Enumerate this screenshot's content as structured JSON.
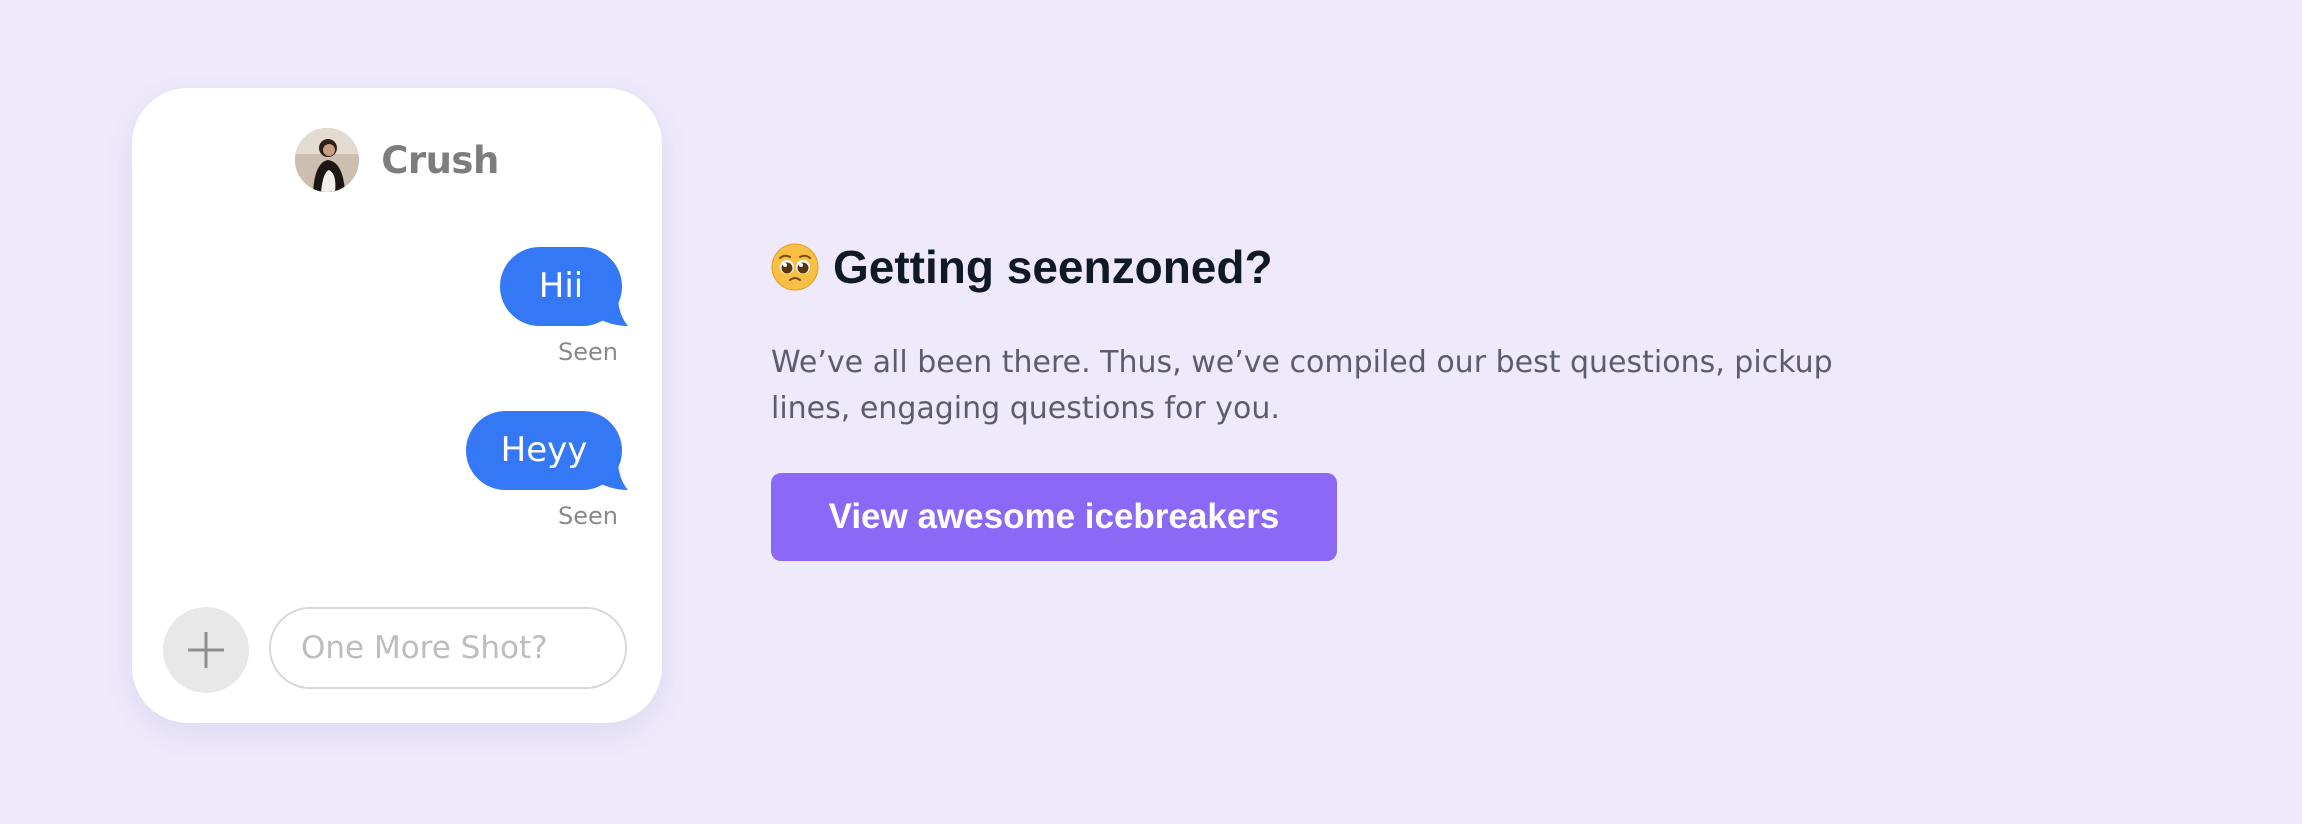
{
  "chat": {
    "contact_name": "Crush",
    "messages": [
      {
        "text": "Hii",
        "status": "Seen"
      },
      {
        "text": "Heyy",
        "status": "Seen"
      }
    ],
    "input_placeholder": "One More Shot?",
    "attach_icon": "plus-icon"
  },
  "promo": {
    "emoji": "pleading-face-icon",
    "title": "Getting seenzoned?",
    "description": "We’ve all been there. Thus, we’ve compiled our best questions, pickup lines, engaging questions for you.",
    "cta_label": "View awesome icebreakers"
  },
  "colors": {
    "background": "#EEEAFB",
    "bubble": "#3478F6",
    "cta": "#8B68F5",
    "heading": "#111827",
    "body_text": "#5B5E6A"
  }
}
